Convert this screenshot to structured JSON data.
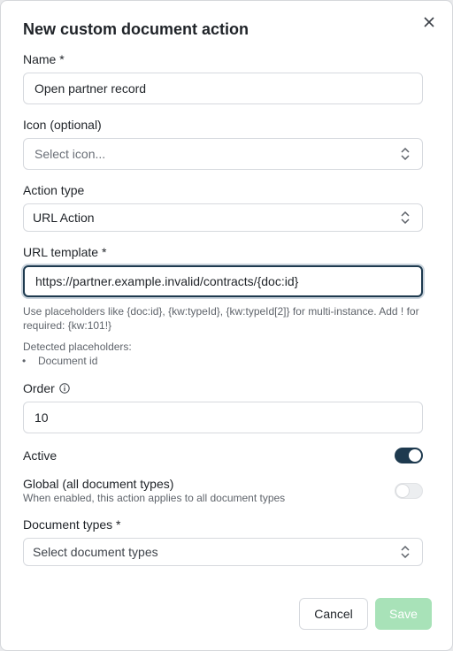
{
  "dialog": {
    "title": "New custom document action",
    "close_icon": "close-icon"
  },
  "fields": {
    "name": {
      "label": "Name *",
      "value": "Open partner record"
    },
    "icon": {
      "label": "Icon (optional)",
      "placeholder": "Select icon..."
    },
    "action_type": {
      "label": "Action type",
      "value": "URL Action"
    },
    "url_template": {
      "label": "URL template *",
      "value": "https://partner.example.invalid/contracts/{doc:id}",
      "help_line1": "Use placeholders like {doc:id}, {kw:typeId}, {kw:typeId[2]} for multi-instance. Add ! for",
      "help_line2": "required: {kw:101!}",
      "detected_label": "Detected placeholders:",
      "detected": [
        "Document id"
      ]
    },
    "order": {
      "label": "Order",
      "value": "10",
      "info_icon": "info-icon"
    },
    "active": {
      "label": "Active",
      "on": true
    },
    "global": {
      "label": "Global (all document types)",
      "help": "When enabled, this action applies to all document types",
      "on": false
    },
    "document_types": {
      "label": "Document types *",
      "placeholder": "Select document types"
    }
  },
  "footer": {
    "cancel_label": "Cancel",
    "save_label": "Save"
  },
  "colors": {
    "accent": "#1e3a4f",
    "save_disabled": "#a8e2b8"
  }
}
